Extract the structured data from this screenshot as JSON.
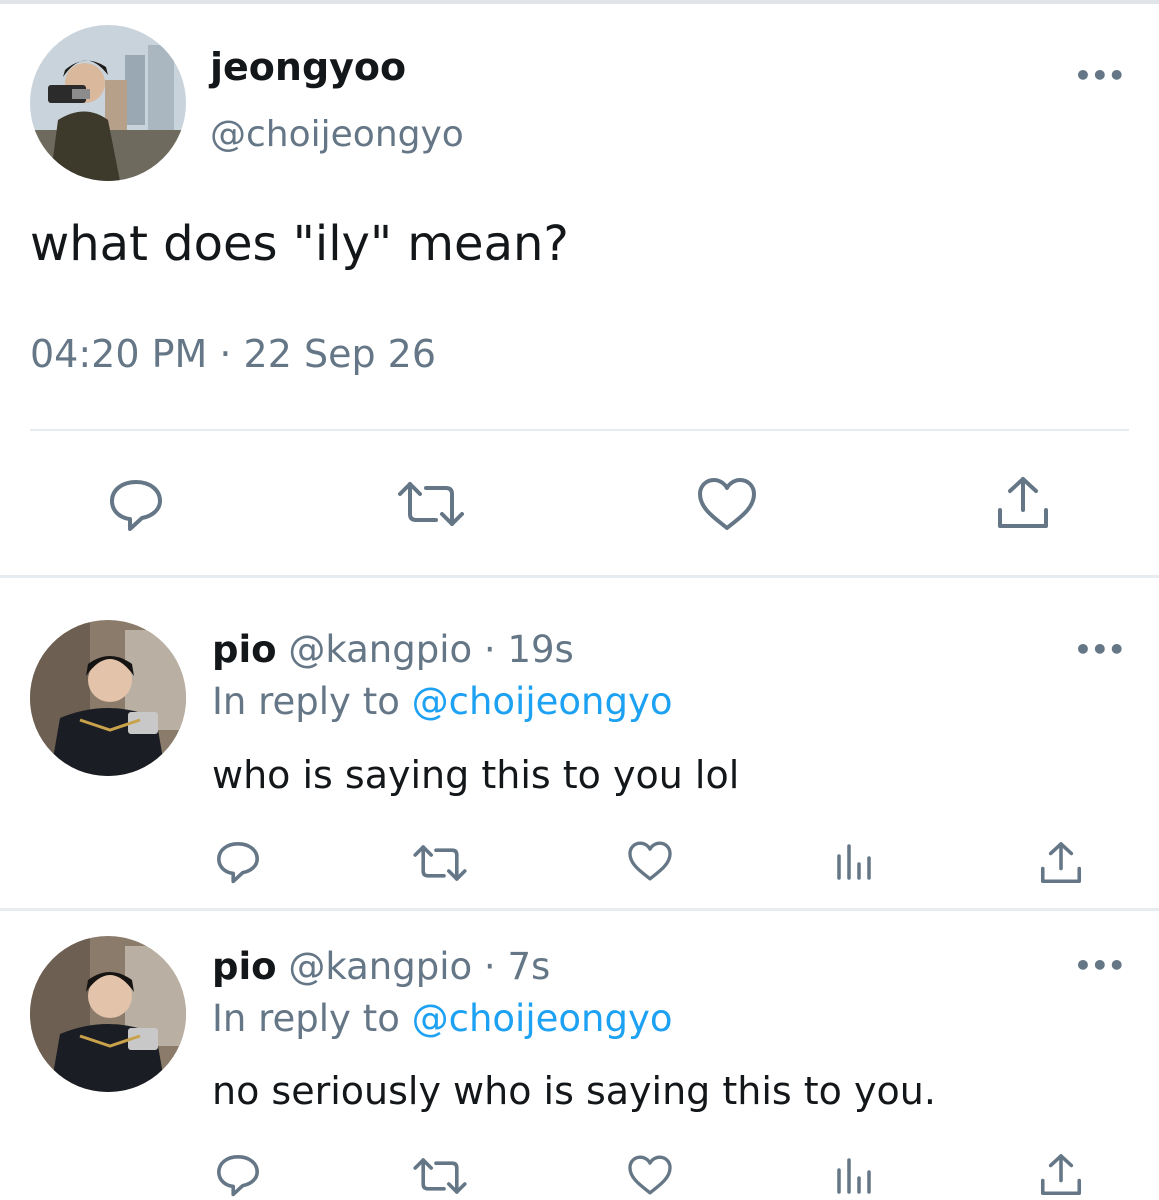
{
  "main_tweet": {
    "display_name": "jeongyoo",
    "handle": "@choijeongyo",
    "text": "what does \"ily\" mean?",
    "timestamp": "04:20 PM · 22 Sep 26",
    "more_label": "•••",
    "actions": [
      "reply-icon",
      "retweet-icon",
      "like-icon",
      "share-icon"
    ]
  },
  "replies": [
    {
      "display_name": "pio",
      "handle": "@kangpio",
      "time": "· 19s",
      "reply_prefix": "In reply to",
      "reply_to": "@choijeongyo",
      "text": "who is saying this to you lol",
      "more_label": "•••",
      "actions": [
        "reply-icon",
        "retweet-icon",
        "like-icon",
        "analytics-icon",
        "share-icon"
      ]
    },
    {
      "display_name": "pio",
      "handle": "@kangpio",
      "time": "· 7s",
      "reply_prefix": "In reply to",
      "reply_to": "@choijeongyo",
      "text": "no seriously who is saying this to you.",
      "more_label": "•••",
      "actions": [
        "reply-icon",
        "retweet-icon",
        "like-icon",
        "analytics-icon",
        "share-icon"
      ]
    }
  ],
  "colors": {
    "text": "#14171a",
    "secondary": "#657786",
    "link": "#1da1f2",
    "divider": "#e6ecf0"
  }
}
